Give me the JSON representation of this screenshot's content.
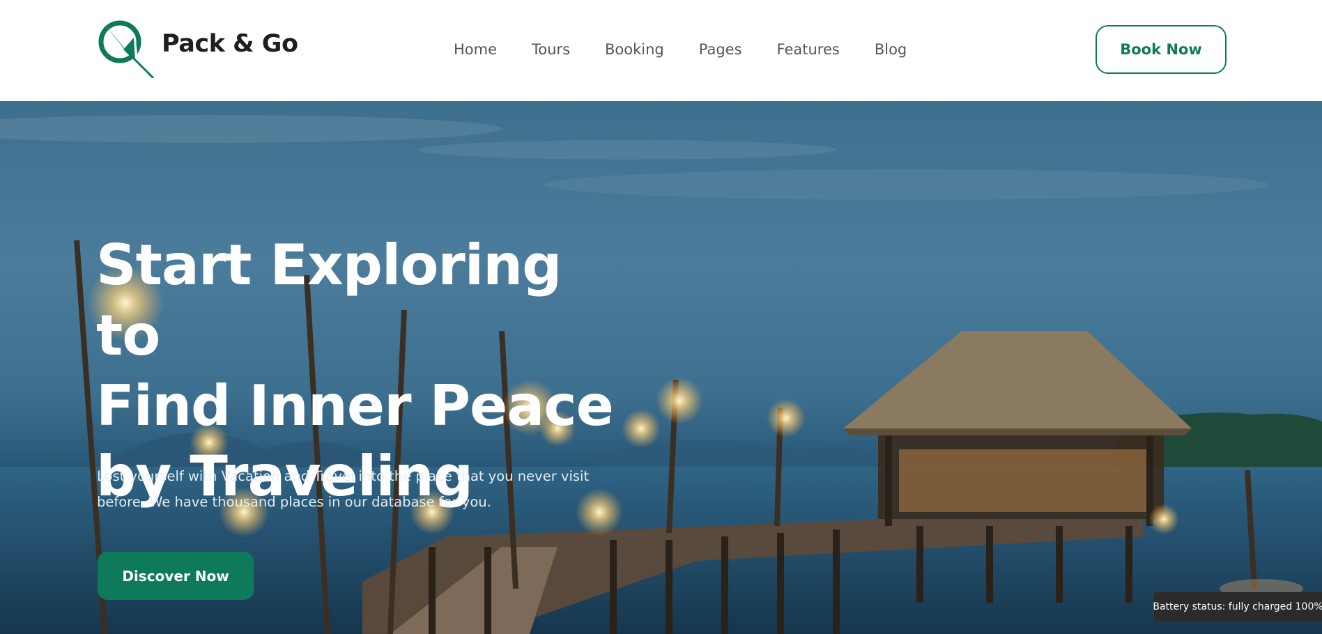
{
  "brand": {
    "name": "Pack & Go",
    "accent_color": "#0e7a5a",
    "logo_icon": "compass-arrow-logo-icon"
  },
  "nav": {
    "items": [
      {
        "label": "Home"
      },
      {
        "label": "Tours"
      },
      {
        "label": "Booking"
      },
      {
        "label": "Pages"
      },
      {
        "label": "Features"
      },
      {
        "label": "Blog"
      }
    ],
    "cta_label": "Book Now"
  },
  "hero": {
    "title_lines": [
      "Start Exploring to",
      "Find Inner Peace",
      "by Traveling"
    ],
    "description": "Lost yourself with Vacation and Travel into the place that you never visit before. We have thousand places in our database for you.",
    "button_label": "Discover Now"
  },
  "system": {
    "battery_status": "Battery status: fully charged 100%"
  }
}
